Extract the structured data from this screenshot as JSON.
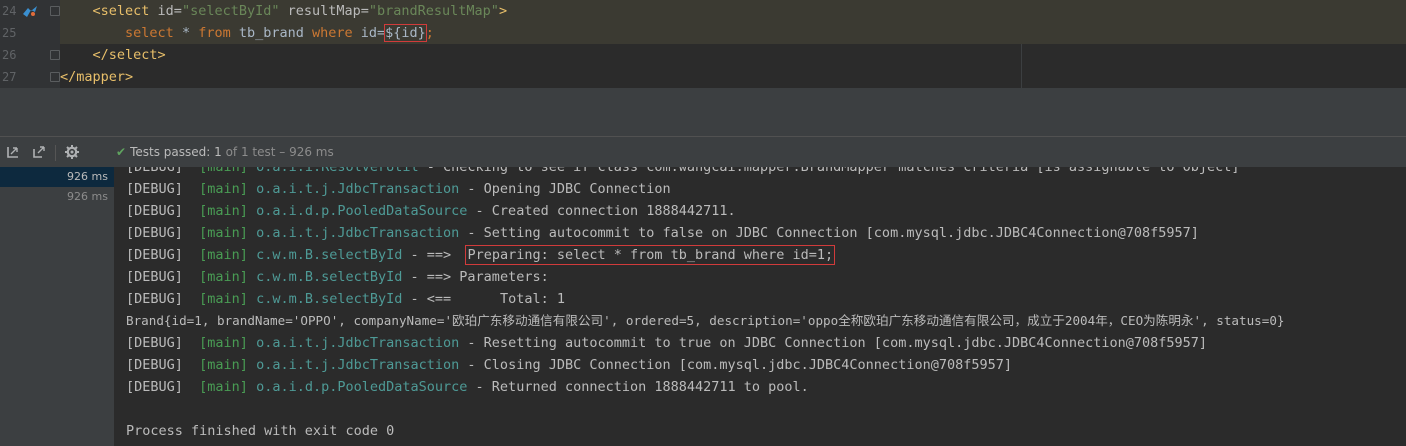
{
  "editor": {
    "lines": [
      {
        "num": "24",
        "indent": "    ",
        "tag_open": "<select ",
        "attr1": "id=",
        "val1": "\"selectById\"",
        "attr2": " resultMap=",
        "val2": "\"brandResultMap\"",
        "tag_close": ">"
      },
      {
        "num": "25",
        "indent": "        ",
        "kw1": "select",
        "sp1": " * ",
        "kw2": "from",
        "sp2": " tb_brand ",
        "kw3": "where",
        "sp3": " id=",
        "param": "${id}",
        "semi": ";"
      },
      {
        "num": "26",
        "indent": "    ",
        "tag": "</select>"
      },
      {
        "num": "27",
        "indent": "",
        "tag": "</mapper>"
      }
    ]
  },
  "test_toolbar": {
    "status": "Tests passed:",
    "passed": "1",
    "detail": "of 1 test – 926 ms"
  },
  "test_tree": [
    {
      "time": "926 ms",
      "selected": true
    },
    {
      "time": "926 ms",
      "selected": false
    }
  ],
  "console": {
    "lines": [
      {
        "level": "[DEBUG]",
        "thread": "[main]",
        "logger": "o.a.i.i.ResolverUtil",
        "message": " - Checking to see if class com.wangcai.mapper.BrandMapper matches criteria [is assignable to Object]"
      },
      {
        "level": "[DEBUG]",
        "thread": "[main]",
        "logger": "o.a.i.t.j.JdbcTransaction",
        "message": " - Opening JDBC Connection"
      },
      {
        "level": "[DEBUG]",
        "thread": "[main]",
        "logger": "o.a.i.d.p.PooledDataSource",
        "message": " - Created connection 1888442711."
      },
      {
        "level": "[DEBUG]",
        "thread": "[main]",
        "logger": "o.a.i.t.j.JdbcTransaction",
        "message": " - Setting autocommit to false on JDBC Connection [com.mysql.jdbc.JDBC4Connection@708f5957]"
      },
      {
        "level": "[DEBUG]",
        "thread": "[main]",
        "logger": "c.w.m.B.selectById",
        "message": " - ==>  ",
        "boxed": "Preparing: select * from tb_brand where id=1;"
      },
      {
        "level": "[DEBUG]",
        "thread": "[main]",
        "logger": "c.w.m.B.selectById",
        "message": " - ==> Parameters: "
      },
      {
        "level": "[DEBUG]",
        "thread": "[main]",
        "logger": "c.w.m.B.selectById",
        "message": " - <==      Total: 1"
      },
      {
        "plain": "Brand{id=1, brandName='OPPO', companyName='欧珀广东移动通信有限公司', ordered=5, description='oppo全称欧珀广东移动通信有限公司，成立于2004年，CEO为陈明永', status=0}"
      },
      {
        "level": "[DEBUG]",
        "thread": "[main]",
        "logger": "o.a.i.t.j.JdbcTransaction",
        "message": " - Resetting autocommit to true on JDBC Connection [com.mysql.jdbc.JDBC4Connection@708f5957]"
      },
      {
        "level": "[DEBUG]",
        "thread": "[main]",
        "logger": "o.a.i.t.j.JdbcTransaction",
        "message": " - Closing JDBC Connection [com.mysql.jdbc.JDBC4Connection@708f5957]"
      },
      {
        "level": "[DEBUG]",
        "thread": "[main]",
        "logger": "o.a.i.d.p.PooledDataSource",
        "message": " - Returned connection 1888442711 to pool."
      },
      {
        "plain": ""
      },
      {
        "plain": "Process finished with exit code 0"
      }
    ]
  },
  "colors": {
    "background": "#2b2b2b",
    "tag": "#e8bf6a",
    "keyword": "#cc7832",
    "string": "#6a8759",
    "thread": "#499c54",
    "logger": "#4e9a96",
    "highlight_box": "#d13b3b",
    "passed": "#5fa35f"
  },
  "icons": [
    "mapper-gutter-icon",
    "fold-marker-icon",
    "sort-alphabetically-icon",
    "expand-icon",
    "settings-gear-icon",
    "check-icon"
  ]
}
